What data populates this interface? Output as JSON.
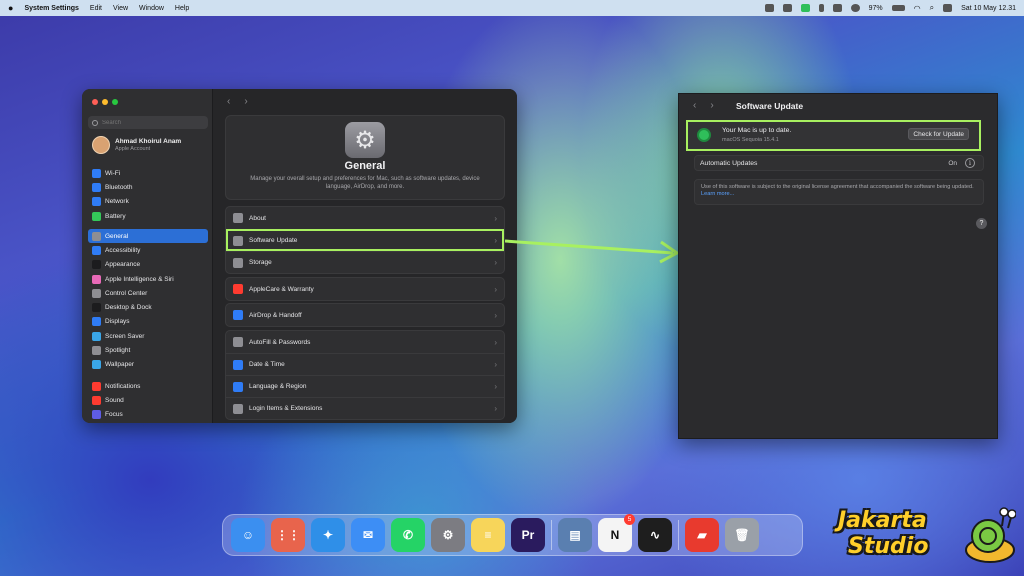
{
  "menubar": {
    "apple": "",
    "app_name": "System Settings",
    "menus": [
      "Edit",
      "View",
      "Window",
      "Help"
    ],
    "battery": "97%",
    "datetime": "Sat 10 May  12.31"
  },
  "settings": {
    "search_placeholder": "Search",
    "account": {
      "name": "Ahmad Khoirul Anam",
      "subtitle": "Apple Account"
    },
    "sidebar": {
      "network_items": [
        {
          "label": "Wi-Fi",
          "color": "#2f7cf6"
        },
        {
          "label": "Bluetooth",
          "color": "#2f7cf6"
        },
        {
          "label": "Network",
          "color": "#2f7cf6"
        },
        {
          "label": "Battery",
          "color": "#34c759"
        }
      ],
      "system_items": [
        {
          "label": "General",
          "color": "#8e8e93",
          "selected": true
        },
        {
          "label": "Accessibility",
          "color": "#2f7cf6"
        },
        {
          "label": "Appearance",
          "color": "#1c1c1e"
        },
        {
          "label": "Apple Intelligence & Siri",
          "color": "#e86ab8"
        },
        {
          "label": "Control Center",
          "color": "#8e8e93"
        },
        {
          "label": "Desktop & Dock",
          "color": "#1c1c1e"
        },
        {
          "label": "Displays",
          "color": "#2f7cf6"
        },
        {
          "label": "Screen Saver",
          "color": "#3aa6e8"
        },
        {
          "label": "Spotlight",
          "color": "#8e8e93"
        },
        {
          "label": "Wallpaper",
          "color": "#3aa6e8"
        }
      ],
      "notify_items": [
        {
          "label": "Notifications",
          "color": "#ff3b30"
        },
        {
          "label": "Sound",
          "color": "#ff3b30"
        },
        {
          "label": "Focus",
          "color": "#5e5ce6"
        }
      ]
    },
    "general": {
      "title": "General",
      "description": "Manage your overall setup and preferences for Mac, such as software updates, device language, AirDrop, and more."
    },
    "groups": [
      [
        {
          "label": "About",
          "color": "#8e8e93"
        },
        {
          "label": "Software Update",
          "color": "#8e8e93",
          "highlighted": true
        },
        {
          "label": "Storage",
          "color": "#8e8e93"
        }
      ],
      [
        {
          "label": "AppleCare & Warranty",
          "color": "#ff3b30"
        }
      ],
      [
        {
          "label": "AirDrop & Handoff",
          "color": "#2f7cf6"
        }
      ],
      [
        {
          "label": "AutoFill & Passwords",
          "color": "#8e8e93"
        },
        {
          "label": "Date & Time",
          "color": "#2f7cf6"
        },
        {
          "label": "Language & Region",
          "color": "#2f7cf6"
        },
        {
          "label": "Login Items & Extensions",
          "color": "#8e8e93"
        }
      ]
    ],
    "chevron": "›"
  },
  "update_panel": {
    "title": "Software Update",
    "status_title": "Your Mac is up to date.",
    "status_subtitle": "macOS Sequoia 15.4.1",
    "check_button": "Check for Update",
    "auto_updates_label": "Automatic Updates",
    "auto_updates_value": "On",
    "license_text": "Use of this software is subject to the original license agreement that accompanied the software being updated.",
    "license_link": "Learn more...",
    "help": "?"
  },
  "dock": {
    "apps": [
      {
        "name": "finder-icon",
        "color": "#3b8ff0",
        "glyph": "☺"
      },
      {
        "name": "launchpad-icon",
        "color": "#e8644c",
        "glyph": "⋮⋮"
      },
      {
        "name": "safari-icon",
        "color": "#2f8fe8",
        "glyph": "✦"
      },
      {
        "name": "mail-icon",
        "color": "#3d8ef5",
        "glyph": "✉"
      },
      {
        "name": "whatsapp-icon",
        "color": "#25d366",
        "glyph": "✆"
      },
      {
        "name": "system-settings-icon",
        "color": "#7c7c82",
        "glyph": "⚙"
      },
      {
        "name": "notes-icon",
        "color": "#f7d55a",
        "glyph": "≡"
      },
      {
        "name": "premiere-pro-icon",
        "color": "#2a1b5e",
        "glyph": "Pr"
      }
    ],
    "apps2": [
      {
        "name": "preview-icon",
        "color": "#5a7fb0",
        "glyph": "▤"
      },
      {
        "name": "notion-icon",
        "color": "#f4f4f4",
        "glyph": "N",
        "badge": "5"
      },
      {
        "name": "activity-monitor-icon",
        "color": "#1e1e1e",
        "glyph": "∿"
      }
    ],
    "apps3": [
      {
        "name": "creative-cloud-folder-icon",
        "color": "#e83a2e",
        "glyph": "▰"
      },
      {
        "name": "trash-icon",
        "color": "#9aa0a8",
        "glyph": "🗑"
      }
    ]
  },
  "watermark": {
    "line1": "Jakarta",
    "line2": "Studio"
  }
}
